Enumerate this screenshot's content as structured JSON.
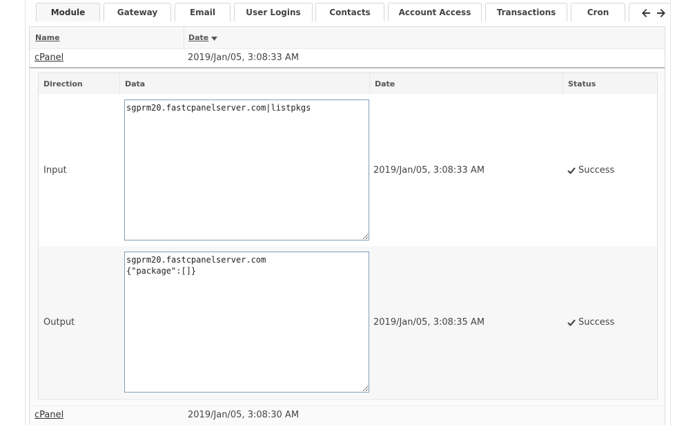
{
  "tabs": [
    {
      "label": "Module",
      "active": true
    },
    {
      "label": "Gateway"
    },
    {
      "label": "Email"
    },
    {
      "label": "User Logins"
    },
    {
      "label": "Contacts"
    },
    {
      "label": "Account Access"
    },
    {
      "label": "Transactions"
    },
    {
      "label": "Cron"
    }
  ],
  "tab_nav": {
    "prev_icon": "arrow-left-icon",
    "next_icon": "arrow-right-icon"
  },
  "table": {
    "headers": {
      "name": "Name",
      "date": "Date"
    },
    "sort_icon": "caret-down-icon",
    "rows": [
      {
        "name": "cPanel",
        "date": "2019/Jan/05, 3:08:33 AM"
      },
      {
        "name": "cPanel",
        "date": "2019/Jan/05, 3:08:30 AM"
      }
    ]
  },
  "detail": {
    "headers": {
      "direction": "Direction",
      "data": "Data",
      "date": "Date",
      "status": "Status"
    },
    "rows": [
      {
        "direction": "Input",
        "data": "sgprm20.fastcpanelserver.com|listpkgs",
        "date": "2019/Jan/05, 3:08:33 AM",
        "status": "Success"
      },
      {
        "direction": "Output",
        "data": "sgprm20.fastcpanelserver.com\n{\"package\":[]}",
        "date": "2019/Jan/05, 3:08:35 AM",
        "status": "Success"
      }
    ],
    "status_icon": "checkmark-icon"
  },
  "colors": {
    "accent_border": "#7f9db9",
    "text": "#444444"
  }
}
